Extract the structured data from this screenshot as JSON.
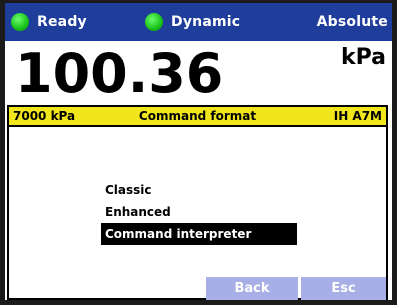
{
  "status_bar": {
    "ready_label": "Ready",
    "mode_label": "Dynamic",
    "reference_label": "Absolute",
    "indicator_color": "#17c117",
    "bar_color": "#1f3d9a"
  },
  "reading": {
    "value": "100.36",
    "unit": "kPa"
  },
  "dialog": {
    "header": {
      "range": "7000 kPa",
      "title": "Command format",
      "model": "IH A7M",
      "color": "#f1e51b"
    },
    "options": [
      {
        "label": "Classic",
        "selected": false
      },
      {
        "label": "Enhanced",
        "selected": false
      },
      {
        "label": "Command interpreter",
        "selected": true
      }
    ],
    "softkeys": {
      "back": "Back",
      "esc": "Esc"
    }
  }
}
